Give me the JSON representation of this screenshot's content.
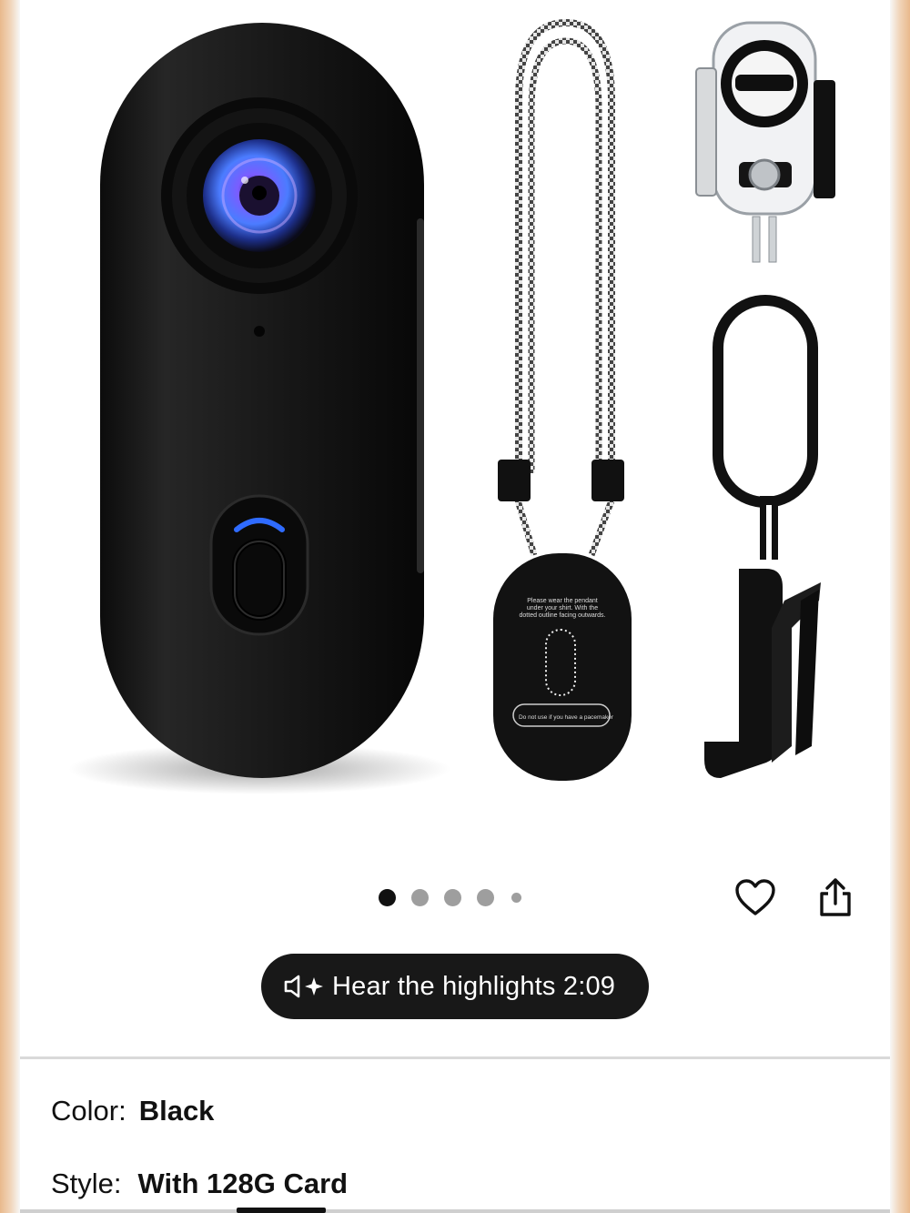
{
  "gallery": {
    "image_alt": "Mini body camera with lanyard pendant, waterproof case, sim tool and clip",
    "pendant_text_top": "Please wear the pendant under your shirt. With the dotted outline facing outwards.",
    "pendant_text_warning": "Do not use if you have a pacemaker",
    "page_count": 5,
    "current_page": 1
  },
  "actions": {
    "wishlist_icon": "heart-icon",
    "share_icon": "share-icon"
  },
  "audio": {
    "label": "Hear the highlights 2:09",
    "icon": "speaker-sparkle-icon"
  },
  "variants": {
    "color_label": "Color:",
    "color_value": "Black",
    "style_label": "Style:",
    "style_value": "With 128G Card"
  },
  "colors": {
    "accent_blue": "#2f6bff",
    "pill_bg": "#181818"
  }
}
